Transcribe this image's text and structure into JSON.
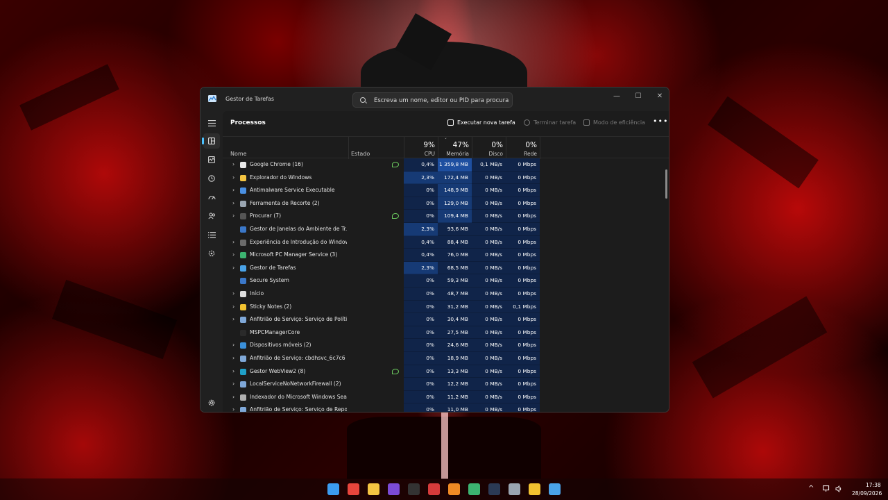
{
  "window": {
    "title": "Gestor de Tarefas",
    "search_placeholder": "Escreva um nome, editor ou PID para procurar",
    "controls": {
      "minimize": "—",
      "maximize": "☐",
      "close": "✕"
    }
  },
  "nav": {
    "items": [
      {
        "name": "hamburger-icon"
      },
      {
        "name": "processes-icon",
        "active": true
      },
      {
        "name": "performance-icon"
      },
      {
        "name": "app-history-icon"
      },
      {
        "name": "startup-apps-icon"
      },
      {
        "name": "users-icon"
      },
      {
        "name": "details-icon"
      },
      {
        "name": "services-icon"
      },
      {
        "name": "settings-icon"
      }
    ]
  },
  "page": {
    "title": "Processos",
    "run_new_task": "Executar nova tarefa",
    "end_task": "Terminar tarefa",
    "efficiency_mode": "Modo de eficiência",
    "more": "•••"
  },
  "columns": {
    "name": "Nome",
    "status": "Estado",
    "cpu_pct": "9%",
    "cpu": "CPU",
    "mem_pct": "47%",
    "mem": "Memória",
    "disk_pct": "0%",
    "disk": "Disco",
    "net_pct": "0%",
    "net": "Rede",
    "sort_indicator": "ˇ"
  },
  "processes": [
    {
      "name": "Google Chrome (16)",
      "expand": true,
      "eco": true,
      "cpu": "0,4%",
      "mem": "1 359,8 MB",
      "disk": "0,1 MB/s",
      "net": "0 Mbps",
      "icon_color": "#e8e8e8"
    },
    {
      "name": "Explorador do Windows",
      "expand": true,
      "eco": false,
      "cpu": "2,3%",
      "mem": "172,4 MB",
      "disk": "0 MB/s",
      "net": "0 Mbps",
      "icon_color": "#f5c542"
    },
    {
      "name": "Antimalware Service Executable",
      "expand": true,
      "eco": false,
      "cpu": "0%",
      "mem": "148,9 MB",
      "disk": "0 MB/s",
      "net": "0 Mbps",
      "icon_color": "#4a90e2"
    },
    {
      "name": "Ferramenta de Recorte (2)",
      "expand": true,
      "eco": false,
      "cpu": "0%",
      "mem": "129,0 MB",
      "disk": "0 MB/s",
      "net": "0 Mbps",
      "icon_color": "#9aa5b1"
    },
    {
      "name": "Procurar (7)",
      "expand": true,
      "eco": true,
      "cpu": "0%",
      "mem": "109,4 MB",
      "disk": "0 MB/s",
      "net": "0 Mbps",
      "icon_color": "#555555"
    },
    {
      "name": "Gestor de Janelas do Ambiente de Tr...",
      "expand": false,
      "eco": false,
      "cpu": "2,3%",
      "mem": "93,6 MB",
      "disk": "0 MB/s",
      "net": "0 Mbps",
      "icon_color": "#3b78c9"
    },
    {
      "name": "Experiência de Introdução do Windows",
      "expand": true,
      "eco": false,
      "cpu": "0,4%",
      "mem": "88,4 MB",
      "disk": "0 MB/s",
      "net": "0 Mbps",
      "icon_color": "#6b6b6b"
    },
    {
      "name": "Microsoft PC Manager Service (3)",
      "expand": true,
      "eco": false,
      "cpu": "0,4%",
      "mem": "76,0 MB",
      "disk": "0 MB/s",
      "net": "0 Mbps",
      "icon_color": "#3cb371"
    },
    {
      "name": "Gestor de Tarefas",
      "expand": true,
      "eco": false,
      "cpu": "2,3%",
      "mem": "68,5 MB",
      "disk": "0 MB/s",
      "net": "0 Mbps",
      "icon_color": "#4aa3e8"
    },
    {
      "name": "Secure System",
      "expand": false,
      "eco": false,
      "cpu": "0%",
      "mem": "59,3 MB",
      "disk": "0 MB/s",
      "net": "0 Mbps",
      "icon_color": "#3b78c9"
    },
    {
      "name": "Início",
      "expand": true,
      "eco": false,
      "cpu": "0%",
      "mem": "48,7 MB",
      "disk": "0 MB/s",
      "net": "0 Mbps",
      "icon_color": "#dddddd"
    },
    {
      "name": "Sticky Notes (2)",
      "expand": true,
      "eco": false,
      "cpu": "0%",
      "mem": "31,2 MB",
      "disk": "0 MB/s",
      "net": "0,1 Mbps",
      "icon_color": "#f2c230"
    },
    {
      "name": "Anfitrião de Serviço: Serviço de Políti...",
      "expand": true,
      "eco": false,
      "cpu": "0%",
      "mem": "30,4 MB",
      "disk": "0 MB/s",
      "net": "0 Mbps",
      "icon_color": "#7fa8d8"
    },
    {
      "name": "MSPCManagerCore",
      "expand": false,
      "eco": false,
      "cpu": "0%",
      "mem": "27,5 MB",
      "disk": "0 MB/s",
      "net": "0 Mbps",
      "icon_color": "#2a2a2a"
    },
    {
      "name": "Dispositivos móveis (2)",
      "expand": true,
      "eco": false,
      "cpu": "0%",
      "mem": "24,6 MB",
      "disk": "0 MB/s",
      "net": "0 Mbps",
      "icon_color": "#3a8fd9"
    },
    {
      "name": "Anfitrião de Serviço: cbdhsvc_6c7c6",
      "expand": true,
      "eco": false,
      "cpu": "0%",
      "mem": "18,9 MB",
      "disk": "0 MB/s",
      "net": "0 Mbps",
      "icon_color": "#7fa8d8"
    },
    {
      "name": "Gestor WebView2 (8)",
      "expand": true,
      "eco": true,
      "cpu": "0%",
      "mem": "13,3 MB",
      "disk": "0 MB/s",
      "net": "0 Mbps",
      "icon_color": "#1fa0c8"
    },
    {
      "name": "LocalServiceNoNetworkFirewall (2)",
      "expand": true,
      "eco": false,
      "cpu": "0%",
      "mem": "12,2 MB",
      "disk": "0 MB/s",
      "net": "0 Mbps",
      "icon_color": "#7fa8d8"
    },
    {
      "name": "Indexador do Microsoft Windows Sea...",
      "expand": true,
      "eco": false,
      "cpu": "0%",
      "mem": "11,2 MB",
      "disk": "0 MB/s",
      "net": "0 Mbps",
      "icon_color": "#b0b0b0"
    },
    {
      "name": "Anfitrião de Serviço: Serviço de Repo...",
      "expand": true,
      "eco": false,
      "cpu": "0%",
      "mem": "11,0 MB",
      "disk": "0 MB/s",
      "net": "0 Mbps",
      "icon_color": "#7fa8d8"
    }
  ],
  "colors": {
    "accent": "#4cc2ff",
    "heat_low": "#102449",
    "heat_mid": "#163a75",
    "heat_high": "#1e4fa0"
  },
  "taskbar": {
    "icons": [
      {
        "name": "windows-start-icon",
        "color": "#3b9cf0"
      },
      {
        "name": "chrome-icon",
        "color": "#e8453c"
      },
      {
        "name": "file-explorer-icon",
        "color": "#f5c542"
      },
      {
        "name": "app-purple-icon",
        "color": "#7b4bd6"
      },
      {
        "name": "github-icon",
        "color": "#333333"
      },
      {
        "name": "app-red-icon",
        "color": "#d63b3b"
      },
      {
        "name": "app-orange-icon",
        "color": "#f08a24"
      },
      {
        "name": "app-green-icon",
        "color": "#3cb371"
      },
      {
        "name": "terminal-icon",
        "color": "#2b3a55"
      },
      {
        "name": "pen-icon",
        "color": "#9aa5b1"
      },
      {
        "name": "sticky-notes-icon",
        "color": "#f2c230"
      },
      {
        "name": "task-manager-icon",
        "color": "#4aa3e8"
      }
    ],
    "chevron": "^",
    "time": "17:38",
    "date": "28/09/2026"
  }
}
